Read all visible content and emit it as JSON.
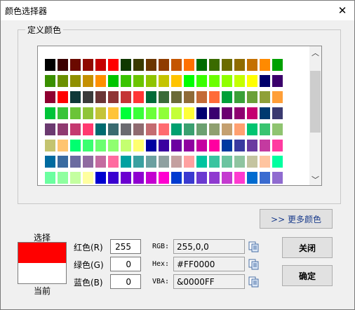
{
  "window": {
    "title": "颜色选择器"
  },
  "group": {
    "label": "定义颜色"
  },
  "palette": [
    [
      "#000000",
      "#3a0000",
      "#6b0a00",
      "#8f0a00",
      "#c40000",
      "#ff0000",
      "#0f3800",
      "#3a3a00",
      "#6b3500",
      "#8f3c00",
      "#c45500",
      "#ff7000",
      "#006b00",
      "#3a6b00",
      "#6b6b00",
      "#8f6b00",
      "#c47000",
      "#ff8a00",
      "#00a000"
    ],
    [
      "#3a8f00",
      "#6b8f00",
      "#8f8f00",
      "#c48f00",
      "#ff8f00",
      "#00c400",
      "#3ac400",
      "#6bc400",
      "#8fc400",
      "#c4c400",
      "#ffc400",
      "#00ff00",
      "#3aff00",
      "#6bff00",
      "#8fff00",
      "#c4ff00",
      "#ffff00",
      "#00006b",
      "#3a006b"
    ],
    [
      "#8f0030",
      "#ff0000",
      "#0f3838",
      "#3a3a3a",
      "#6b3535",
      "#8f3535",
      "#c43535",
      "#ff3535",
      "#006b38",
      "#3a6b38",
      "#6b6b38",
      "#8f6b38",
      "#c46b38",
      "#ff6b38",
      "#00a038",
      "#3aa038",
      "#6ba038",
      "#8fa038",
      "#ff9f38"
    ],
    [
      "#00c438",
      "#3ac438",
      "#6bc438",
      "#8fc438",
      "#c4c438",
      "#ffc438",
      "#00ff38",
      "#3aff38",
      "#6bff38",
      "#8fff38",
      "#c4ff38",
      "#ffff38",
      "#000070",
      "#3a0070",
      "#6b0070",
      "#8f0070",
      "#c40070",
      "#003a70",
      "#3a3a70"
    ],
    [
      "#6b3a70",
      "#8f3a70",
      "#c43a70",
      "#ff3a70",
      "#006b70",
      "#3a6b70",
      "#6b6b70",
      "#8f6b70",
      "#c46b70",
      "#ff6b70",
      "#00a070",
      "#3aa070",
      "#6ba070",
      "#8fa070",
      "#c4a070",
      "#ffa070",
      "#00c470",
      "#3ac470",
      "#8fc470"
    ],
    [
      "#c4c470",
      "#ffc470",
      "#00ff70",
      "#3aff70",
      "#6bff70",
      "#8fff70",
      "#c4ff70",
      "#ffff70",
      "#0000a0",
      "#3a00a0",
      "#6b00a0",
      "#8f00a0",
      "#c400a0",
      "#ff00a0",
      "#003aa0",
      "#3a3aa0",
      "#6b3aa0",
      "#c43aa0",
      "#ff3aa0"
    ],
    [
      "#006ba0",
      "#3a6ba0",
      "#6b6ba0",
      "#8f6ba0",
      "#c46ba0",
      "#ff6ba0",
      "#00a0a0",
      "#3aa0a0",
      "#6ba0a0",
      "#8fa0a0",
      "#c4a0a0",
      "#ffa0a0",
      "#00c4a0",
      "#3ac4a0",
      "#6bc4a0",
      "#8fc4a0",
      "#c4c4a0",
      "#ffc4a0",
      "#00ffa0"
    ],
    [
      "#6bffa0",
      "#8fffa0",
      "#c4ffa0",
      "#ffffa0",
      "#0000d0",
      "#3a00d0",
      "#6b00d0",
      "#8f00d0",
      "#c400d0",
      "#ff00d0",
      "#003ad0",
      "#3a3ad0",
      "#6b3ad0",
      "#8f3ad0",
      "#c43ad0",
      "#ff3ad0",
      "#006bd0",
      "#3a6bd0",
      "#8f6bd0"
    ]
  ],
  "buttons": {
    "more_colors": ">> 更多颜色",
    "close": "关闭",
    "ok": "确定"
  },
  "preview": {
    "select_label": "选择",
    "current_label": "当前",
    "new_color": "#ff0000",
    "old_color": "#ffffff"
  },
  "rgb": {
    "red_label": "红色(R)",
    "red_value": "255",
    "green_label": "绿色(G)",
    "green_value": "0",
    "blue_label": "蓝色(B)",
    "blue_value": "0"
  },
  "codes": {
    "rgb_label": "RGB:",
    "rgb_value": "255,0,0",
    "hex_label": "Hex:",
    "hex_value": "#FF0000",
    "vba_label": "VBA:",
    "vba_value": "&0000FF"
  }
}
